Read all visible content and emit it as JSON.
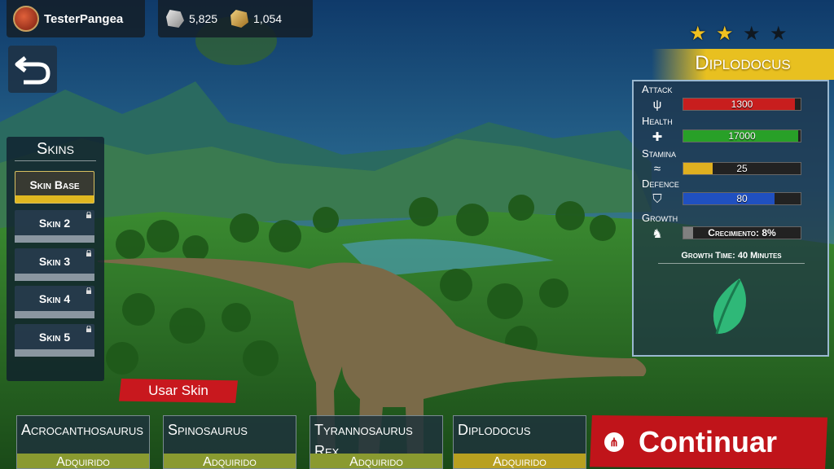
{
  "player": {
    "name": "TesterPangea"
  },
  "currency": {
    "stone": "5,825",
    "gold": "1,054"
  },
  "skins_panel": {
    "title": "Skins",
    "items": [
      {
        "label": "Skin Base",
        "locked": false,
        "active": true
      },
      {
        "label": "Skin 2",
        "locked": true,
        "active": false
      },
      {
        "label": "Skin 3",
        "locked": true,
        "active": false
      },
      {
        "label": "Skin 4",
        "locked": true,
        "active": false
      },
      {
        "label": "Skin 5",
        "locked": true,
        "active": false
      }
    ],
    "use_button": "Usar Skin"
  },
  "dino": {
    "name": "Diplodocus",
    "stars_on": 2,
    "stars_total": 4,
    "stats": {
      "attack": {
        "label": "Attack",
        "value": "1300",
        "fill": 0.95,
        "color": "#c81e1e"
      },
      "health": {
        "label": "Health",
        "value": "17000",
        "fill": 0.98,
        "color": "#28a028"
      },
      "stamina": {
        "label": "Stamina",
        "value": "25",
        "fill": 0.25,
        "color": "#e0b020"
      },
      "defence": {
        "label": "Defence",
        "value": "80",
        "fill": 0.78,
        "color": "#2050c0"
      },
      "growth": {
        "label": "Growth",
        "value": "Crecimiento: 8%",
        "fill": 0.08,
        "color": "#808080"
      }
    },
    "growth_time": "Growth Time: 40 Minutes"
  },
  "dino_cards": [
    {
      "name": "Acrocanthosaurus",
      "status": "Adquirido"
    },
    {
      "name": "Spinosaurus",
      "status": "Adquirido"
    },
    {
      "name": "Tyrannosaurus Rex",
      "status": "Adquirido"
    },
    {
      "name": "Diplodocus",
      "status": "Adquirido"
    }
  ],
  "continue_label": "Continuar",
  "colors": {
    "accent_red": "#c0141a",
    "gold": "#e8c020",
    "acquired_green": "#8a9a30"
  }
}
